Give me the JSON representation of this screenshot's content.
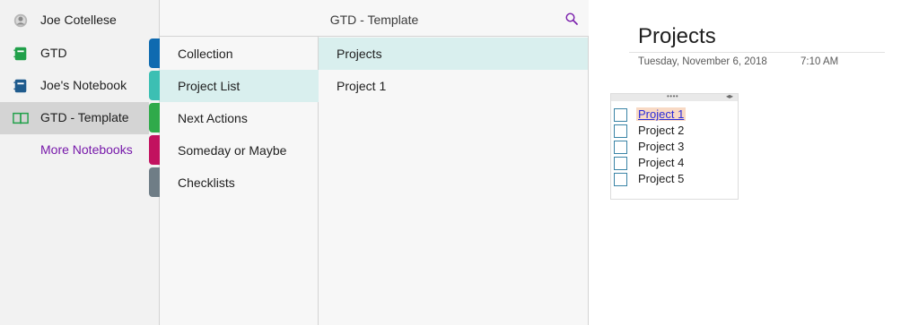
{
  "notebooks_pane": {
    "user": {
      "name": "Joe Cotellese",
      "icon": "user-avatar-icon"
    },
    "notebooks": [
      {
        "label": "GTD",
        "icon": "notebook-icon",
        "color": "#21a04a",
        "selected": false
      },
      {
        "label": "Joe's Notebook",
        "icon": "notebook-icon",
        "color": "#1f5b8d",
        "selected": false
      },
      {
        "label": "GTD - Template",
        "icon": "open-notebook-icon",
        "color": "#21a04a",
        "selected": true
      }
    ],
    "more_notebooks_label": "More Notebooks",
    "section_tab_colors": [
      "#0f6ab0",
      "#3cbfb3",
      "#2faa4a",
      "#c2125f",
      "#6f7d86"
    ]
  },
  "header": {
    "title": "GTD - Template",
    "search_icon": "search-icon",
    "accent": "#7719aa"
  },
  "sections": [
    {
      "label": "Collection",
      "selected": false
    },
    {
      "label": "Project List",
      "selected": true
    },
    {
      "label": "Next Actions",
      "selected": false
    },
    {
      "label": "Someday or Maybe",
      "selected": false
    },
    {
      "label": "Checklists",
      "selected": false
    }
  ],
  "pages": [
    {
      "label": "Projects",
      "selected": true
    },
    {
      "label": "Project 1",
      "selected": false
    }
  ],
  "canvas": {
    "page_title": "Projects",
    "date": "Tuesday, November 6, 2018",
    "time": "7:10 AM",
    "todo_items": [
      {
        "label": "Project 1",
        "is_link": true,
        "checked": false
      },
      {
        "label": "Project 2",
        "is_link": false,
        "checked": false
      },
      {
        "label": "Project 3",
        "is_link": false,
        "checked": false
      },
      {
        "label": "Project 4",
        "is_link": false,
        "checked": false
      },
      {
        "label": "Project 5",
        "is_link": false,
        "checked": false
      }
    ]
  },
  "colors": {
    "selection_teal": "#d9efee",
    "selection_gray": "#d4d4d4",
    "checkbox_border": "#3a84a6"
  }
}
